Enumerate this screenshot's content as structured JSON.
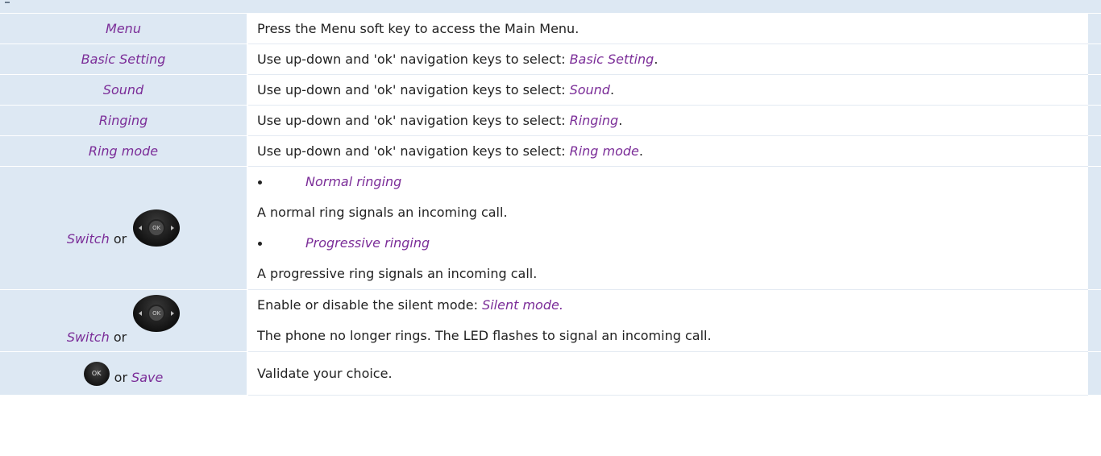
{
  "steps": [
    {
      "action": "Menu",
      "description_text": "Press the Menu soft key to access the Main Menu."
    },
    {
      "action": "Basic Setting",
      "description_prefix": "Use up-down and 'ok' navigation keys to select: ",
      "description_emphasis": "Basic Setting",
      "description_suffix": "."
    },
    {
      "action": "Sound",
      "description_prefix": "Use up-down and 'ok' navigation keys to select: ",
      "description_emphasis": "Sound",
      "description_suffix": "."
    },
    {
      "action": "Ringing",
      "description_prefix": "Use up-down and 'ok' navigation keys to select: ",
      "description_emphasis": "Ringing",
      "description_suffix": "."
    },
    {
      "action": "Ring mode",
      "description_prefix": "Use up-down and 'ok' navigation keys to select: ",
      "description_emphasis": "Ring mode",
      "description_suffix": "."
    },
    {
      "action": "Switch",
      "action_connector": "or",
      "icon": "navigation-key-icon",
      "icon_label": "OK",
      "bullets": [
        {
          "option": "Normal ringing",
          "explanation": "A normal ring signals an incoming call."
        },
        {
          "option": "Progressive ringing",
          "explanation": "A progressive ring signals an incoming call."
        }
      ]
    },
    {
      "action": "Switch",
      "action_connector": "or",
      "icon": "navigation-key-icon",
      "icon_label": "OK",
      "description_prefix": "Enable or disable the silent mode: ",
      "description_emphasis": "Silent mode.",
      "description_line2": "The phone no longer rings. The LED flashes to signal an incoming call."
    },
    {
      "icon": "ok-key-icon",
      "icon_label": "OK",
      "action_connector": "or",
      "action": "Save",
      "description_text": "Validate your choice."
    }
  ],
  "colors": {
    "shaded_column": "#dde8f3",
    "emphasis_text": "#7b2d98",
    "body_text": "#222222"
  }
}
